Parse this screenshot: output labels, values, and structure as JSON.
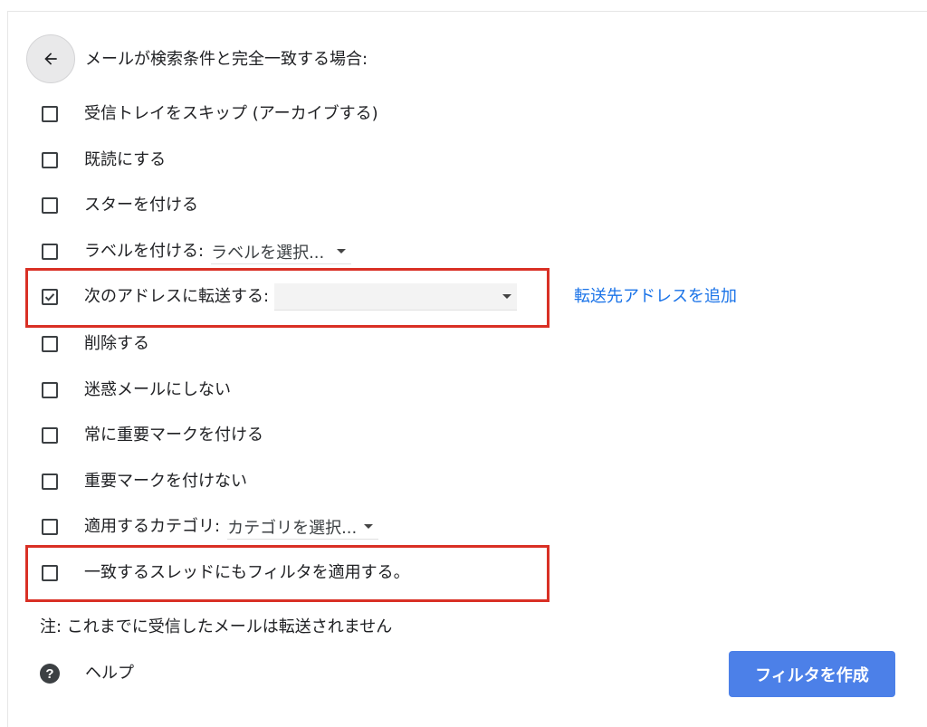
{
  "header": {
    "back_icon": "arrow-back-icon",
    "title": "メールが検索条件と完全一致する場合:"
  },
  "options": [
    {
      "label": "受信トレイをスキップ (アーカイブする)",
      "checked": false
    },
    {
      "label": "既読にする",
      "checked": false
    },
    {
      "label": "スターを付ける",
      "checked": false
    },
    {
      "label": "ラベルを付ける:",
      "checked": false,
      "dropdown": "ラベルを選択..."
    },
    {
      "label": "次のアドレスに転送する:",
      "checked": true,
      "dropdown": ""
    },
    {
      "label": "削除する",
      "checked": false
    },
    {
      "label": "迷惑メールにしない",
      "checked": false
    },
    {
      "label": "常に重要マークを付ける",
      "checked": false
    },
    {
      "label": "重要マークを付けない",
      "checked": false
    },
    {
      "label": "適用するカテゴリ:",
      "checked": false,
      "dropdown": "カテゴリを選択..."
    },
    {
      "label": "一致するスレッドにもフィルタを適用する。",
      "checked": false
    }
  ],
  "forward": {
    "add_address_link": "転送先アドレスを追加"
  },
  "note": "注: これまでに受信したメールは転送されません",
  "help": {
    "icon": "help-icon",
    "label": "ヘルプ"
  },
  "create_button": "フィルタを作成",
  "colors": {
    "accent_blue": "#4c80e8",
    "link_blue": "#1a73e8",
    "highlight_red": "#d93025"
  }
}
